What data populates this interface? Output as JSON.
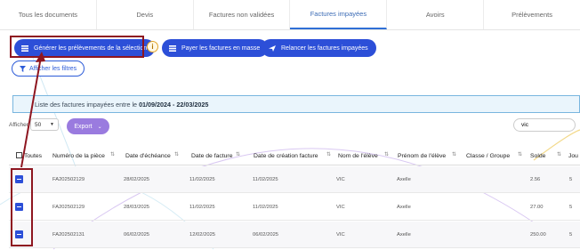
{
  "tabs": [
    "Tous les documents",
    "Devis",
    "Factures non validées",
    "Factures impayées",
    "Avoirs",
    "Prélèvements"
  ],
  "actions": {
    "generate_label": "Générer les prélèvements de la sélection",
    "info_label": "i",
    "pay_label": "Payer les factures en masse",
    "remind_label": "Relancer les factures impayées",
    "filters_label": "Afficher les filtres"
  },
  "banner": {
    "prefix": "Liste des factures impayées entre le",
    "dates": "01/09/2024 - 22/03/2025"
  },
  "controls": {
    "show_label": "Afficher",
    "page_size": "50",
    "export_label": "Export",
    "search_value": "vic"
  },
  "table": {
    "select_all_label": "Toutes",
    "columns": [
      "Numéro de la pièce",
      "Date d'échéance",
      "Date de facture",
      "Date de création facture",
      "Nom de l'élève",
      "Prénom de l'élève",
      "Classe / Groupe",
      "Solde",
      "Jou"
    ],
    "rows": [
      {
        "numero": "FA202502129",
        "echeance": "28/02/2025",
        "date_facture": "11/02/2025",
        "date_creation": "11/02/2025",
        "nom": "VIC",
        "prenom": "Axelle",
        "classe": "",
        "solde": "2.56",
        "jou": "5"
      },
      {
        "numero": "FA202502129",
        "echeance": "28/03/2025",
        "date_facture": "11/02/2025",
        "date_creation": "11/02/2025",
        "nom": "VIC",
        "prenom": "Axelle",
        "classe": "",
        "solde": "27.00",
        "jou": "5"
      },
      {
        "numero": "FA202502131",
        "echeance": "06/02/2025",
        "date_facture": "12/02/2025",
        "date_creation": "06/02/2025",
        "nom": "VIC",
        "prenom": "Axelle",
        "classe": "",
        "solde": "250.00",
        "jou": "5"
      }
    ]
  },
  "colors": {
    "primary": "#2c4fd8",
    "export": "#9a7bdf",
    "highlight": "#8e1620",
    "banner_bg": "#eaf5fc"
  }
}
